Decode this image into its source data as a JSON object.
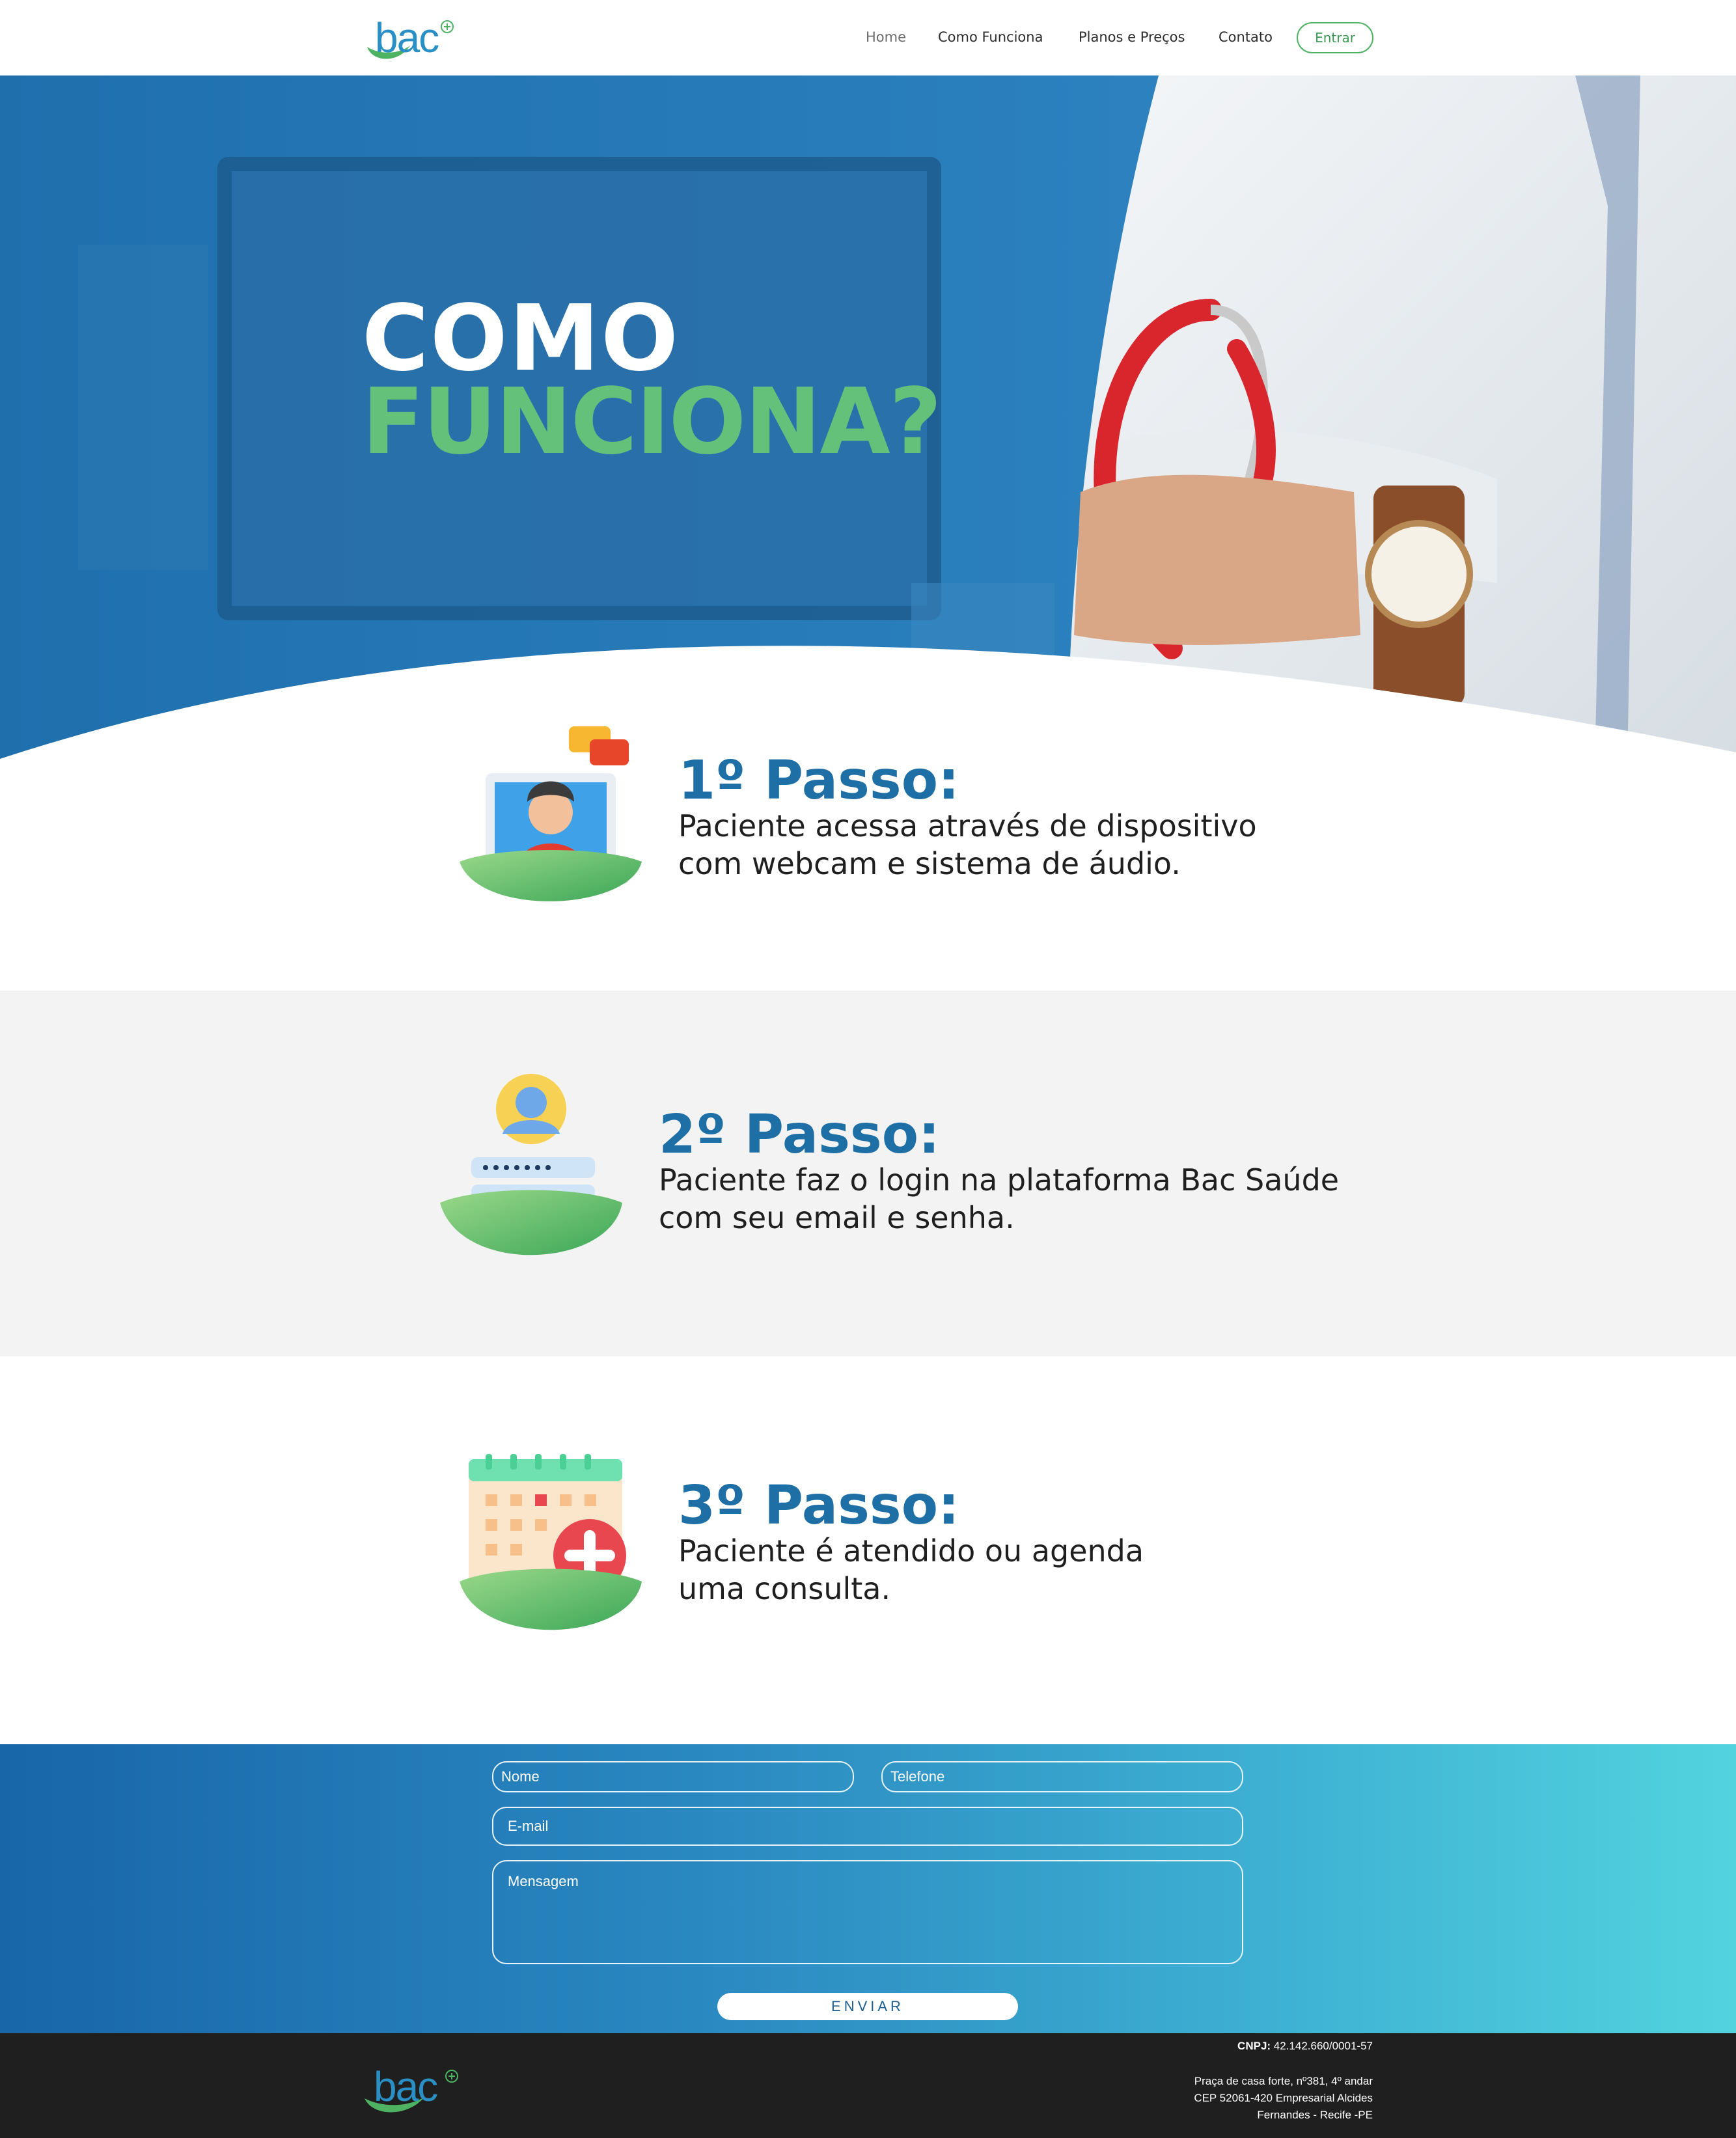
{
  "brand": {
    "logo_text": "bac",
    "primary": "#1e6fa6",
    "accent": "#63c17a"
  },
  "nav": {
    "items": [
      {
        "label": "Home",
        "active": true
      },
      {
        "label": "Como Funciona",
        "active": false
      },
      {
        "label": "Planos e Preços",
        "active": false
      },
      {
        "label": "Contato",
        "active": false
      }
    ],
    "login_label": "Entrar"
  },
  "hero": {
    "title_line1": "COMO",
    "title_line2": "FUNCIONA?"
  },
  "steps": [
    {
      "title": "1º Passo:",
      "text_line1": "Paciente acessa através de dispositivo",
      "text_line2": "com webcam e sistema de áudio.",
      "icon": "video-call-icon"
    },
    {
      "title": "2º Passo:",
      "text_line1": "Paciente faz o login na plataforma Bac Saúde",
      "text_line2": "com seu email e senha.",
      "icon": "login-icon"
    },
    {
      "title": "3º Passo:",
      "text_line1": "Paciente é atendido ou agenda",
      "text_line2": "uma consulta.",
      "icon": "calendar-medical-icon"
    }
  ],
  "form": {
    "name_placeholder": "Nome",
    "phone_placeholder": "Telefone",
    "email_placeholder": "E-mail",
    "message_placeholder": "Mensagem",
    "submit_label": "ENVIAR"
  },
  "footer": {
    "cnpj_label": "CNPJ:",
    "cnpj_value": "42.142.660/0001-57",
    "address_line1": "Praça de casa forte, nº381, 4º andar",
    "address_line2": "CEP 52061-420 Empresarial Alcides",
    "address_line3": "Fernandes - Recife -PE"
  }
}
